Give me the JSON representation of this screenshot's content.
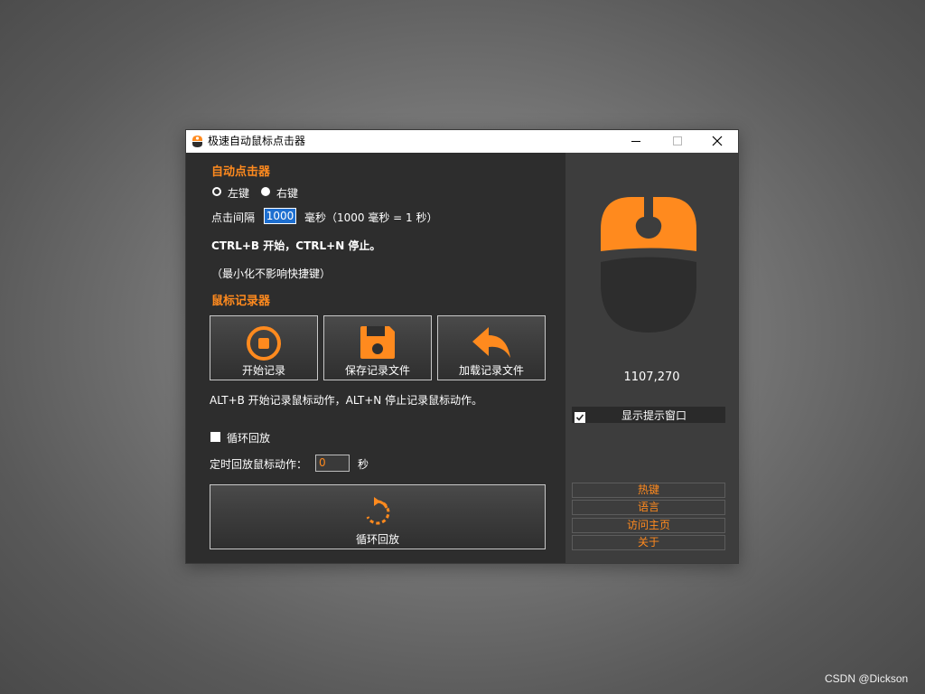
{
  "window": {
    "title": "极速自动鼠标点击器"
  },
  "clicker": {
    "section_title": "自动点击器",
    "left_key_label": "左键",
    "right_key_label": "右键",
    "interval_label": "点击间隔",
    "interval_value": "1000",
    "interval_unit": "毫秒（1000 毫秒 = 1 秒）",
    "hotkey_text": "CTRL+B 开始，CTRL+N 停止。",
    "minimize_note": "（最小化不影响快捷键）"
  },
  "recorder": {
    "section_title": "鼠标记录器",
    "buttons": [
      {
        "label": "开始记录",
        "icon": "record-icon"
      },
      {
        "label": "保存记录文件",
        "icon": "save-icon"
      },
      {
        "label": "加载记录文件",
        "icon": "load-icon"
      }
    ],
    "hotkey_text": "ALT+B 开始记录鼠标动作，ALT+N 停止记录鼠标动作。",
    "loop_label": "循环回放",
    "loop_checked": false,
    "timed_label": "定时回放鼠标动作：",
    "timed_value": "0",
    "timed_unit": "秒",
    "playback_label": "循环回放"
  },
  "side": {
    "coordinates": "1107,270",
    "show_tip_label": "显示提示窗口",
    "show_tip_checked": true,
    "links": [
      "热键",
      "语言",
      "访问主页",
      "关于"
    ]
  },
  "watermark": "CSDN @Dickson",
  "colors": {
    "accent": "#ff8a1e",
    "panel_dark": "#2d2d2d",
    "panel_side": "#3d3d3d",
    "selection": "#1e6fd0"
  }
}
